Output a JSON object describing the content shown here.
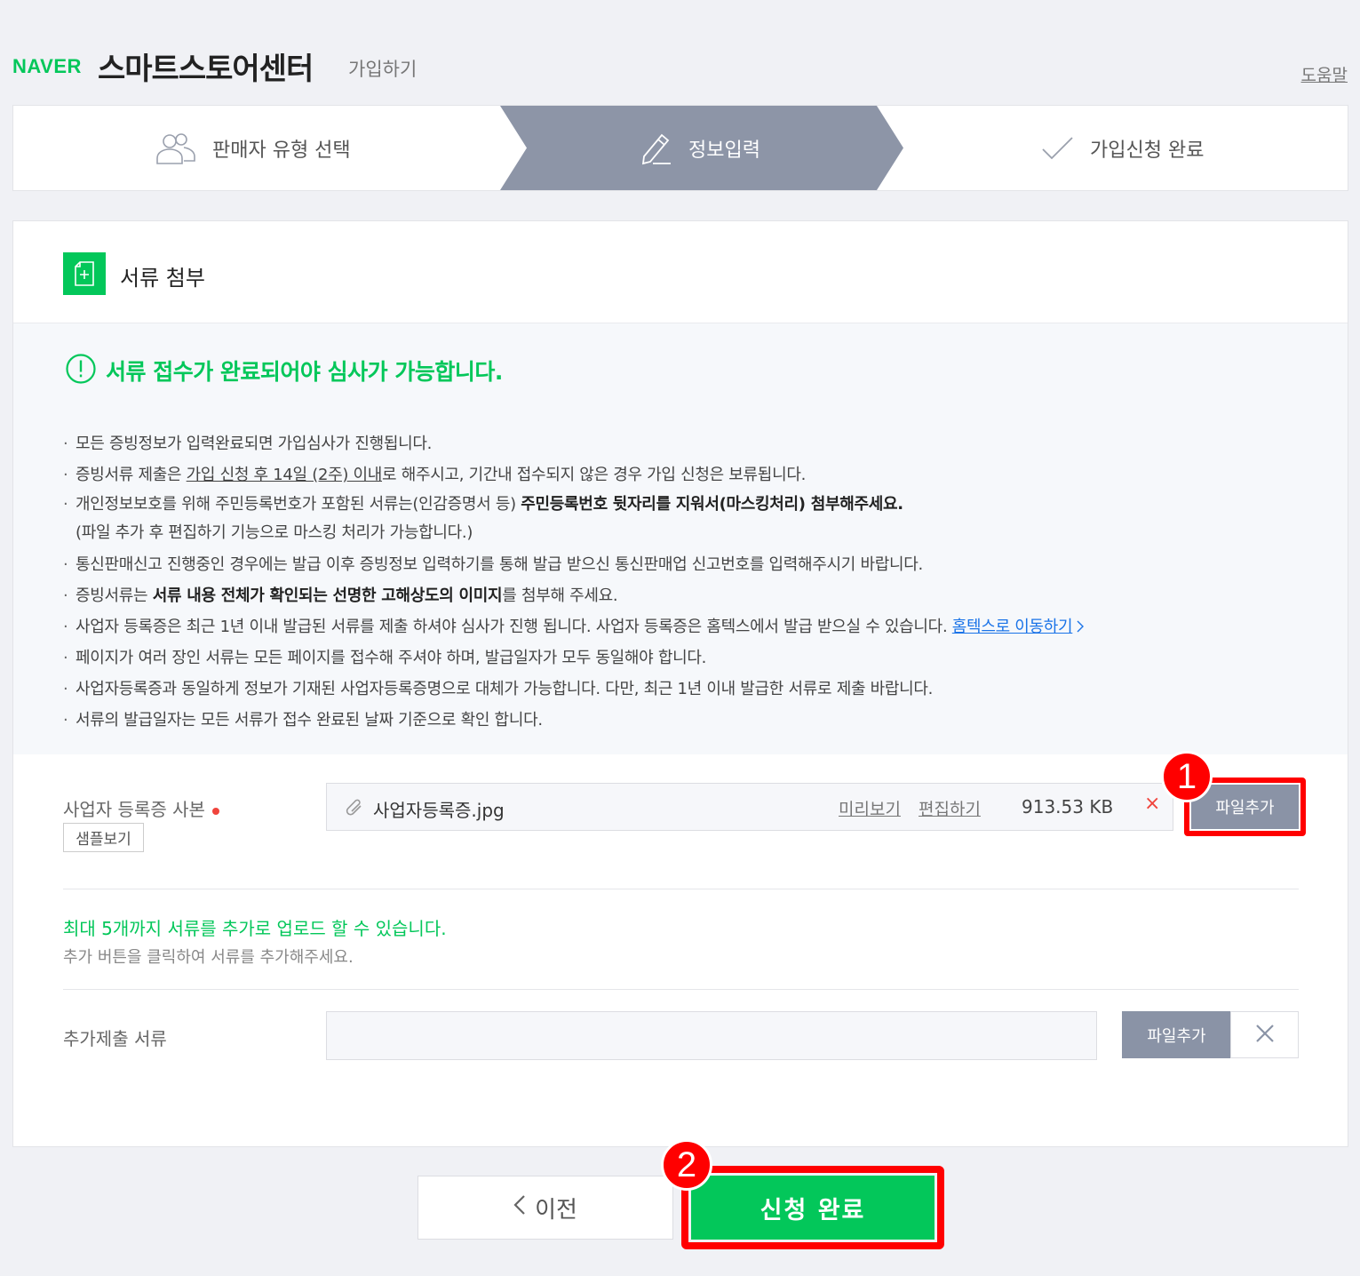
{
  "header": {
    "brand": "NAVER",
    "title": "스마트스토어센터",
    "subtitle": "가입하기",
    "help": "도움말"
  },
  "steps": [
    {
      "label": "판매자 유형 선택",
      "icon": "users-icon",
      "active": false
    },
    {
      "label": "정보입력",
      "icon": "pencil-icon",
      "active": true
    },
    {
      "label": "가입신청 완료",
      "icon": "check-icon",
      "active": false
    }
  ],
  "colors": {
    "accent": "#03c75a",
    "step_active": "#8d95a7",
    "highlight": "#ff0000",
    "danger": "#f0443c",
    "button_gray": "#8a93a6"
  },
  "section": {
    "title": "서류 첨부",
    "icon": "document-add-icon"
  },
  "notice": {
    "title": "서류 접수가 완료되어야 심사가 가능합니다.",
    "items": {
      "i1": "모든 증빙정보가 입력완료되면 가입심사가 진행됩니다.",
      "i2a": "증빙서류 제출은 ",
      "i2b": "가입 신청 후 14일 (2주) 이내",
      "i2c": "로 해주시고, 기간내 접수되지 않은 경우 가입 신청은 보류됩니다.",
      "i3a": "개인정보보호를 위해 주민등록번호가 포함된 서류는(인감증명서 등) ",
      "i3b": "주민등록번호 뒷자리를 지워서(마스킹처리) 첨부해주세요.",
      "i3c": "(파일 추가 후 편집하기 기능으로 마스킹 처리가 가능합니다.)",
      "i4": "통신판매신고 진행중인 경우에는 발급 이후 증빙정보 입력하기를 통해 발급 받으신 통신판매업 신고번호를 입력해주시기 바랍니다.",
      "i5a": "증빙서류는 ",
      "i5b": "서류 내용 전체가 확인되는 선명한 고해상도의 이미지",
      "i5c": "를 첨부해 주세요.",
      "i6a": "사업자 등록증은 최근 1년 이내 발급된 서류를 제출 하셔야 심사가 진행 됩니다. 사업자 등록증은 홈텍스에서 발급 받으실 수 있습니다. ",
      "i6b": "홈텍스로 이동하기",
      "i7": "페이지가 여러 장인 서류는 모든 페이지를 접수해 주셔야 하며, 발급일자가 모두 동일해야 합니다.",
      "i8": "사업자등록증과 동일하게 정보가 기재된 사업자등록증명으로 대체가 가능합니다. 다만, 최근 1년 이내 발급한 서류로 제출 바랍니다.",
      "i9": "서류의 발급일자는 모든 서류가 접수 완료된 날짜 기준으로 확인 합니다."
    }
  },
  "business_doc": {
    "label": "사업자 등록증 사본",
    "sample": "샘플보기",
    "file_name": "사업자등록증.jpg",
    "preview": "미리보기",
    "edit": "편집하기",
    "file_size": "913.53 KB",
    "delete": "×",
    "add": "파일추가",
    "badge": "1"
  },
  "extra": {
    "max_note": "최대 5개까지 서류를 추가로 업로드 할 수 있습니다.",
    "sub_note": "추가 버튼을 클릭하여 서류를 추가해주세요.",
    "label": "추가제출 서류",
    "add": "파일추가"
  },
  "footer": {
    "prev": "이전",
    "submit": "신청 완료",
    "badge": "2"
  }
}
